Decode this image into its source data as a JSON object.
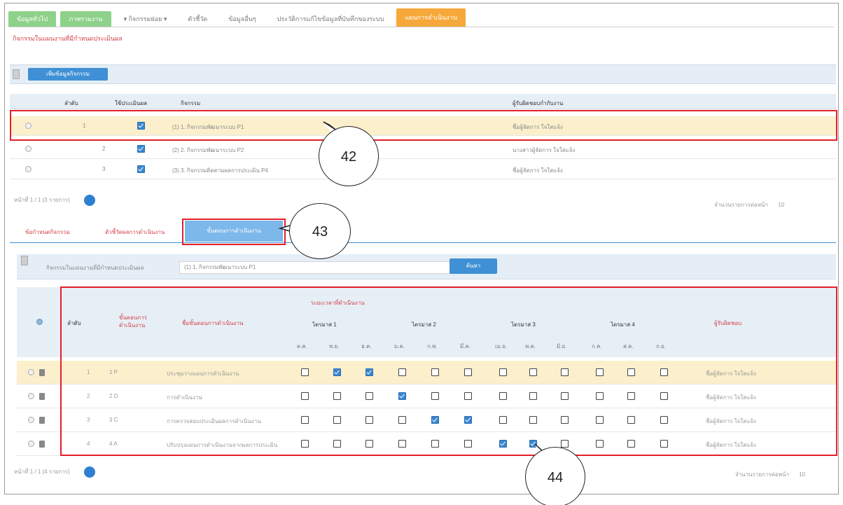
{
  "nav": {
    "tabs": [
      "ข้อมูลทั่วไป",
      "ภาพรวมงาน",
      "▾ กิจกรรมย่อย ▾",
      "ตัวชี้วัด",
      "ข้อมูลอื่นๆ",
      "ประวัติการแก้ไขข้อมูลที่บันทึกของระบบ",
      "แผนการดำเนินงาน"
    ]
  },
  "section_title": "กิจกรรมในแผนงานที่มีกำหนดประเมินผล",
  "add_button": "เพิ่มข้อมูลกิจกรรม",
  "upper_table": {
    "headers": [
      "ลำดับ",
      "ใช้ประเมินผล",
      "กิจกรรม",
      "ผู้รับผิดชอบกำกับงาน"
    ],
    "rows": [
      {
        "no": "1",
        "activity": "(1) 1. กิจกรรมพัฒนาระบบ P1",
        "owner": "ชื่อผู้จัดการ ใจใสแจ้ง"
      },
      {
        "no": "2",
        "activity": "(2) 2. กิจกรรมพัฒนาระบบ P2",
        "owner": "นางสาวผู้จัดการ ใจใสแจ้ง"
      },
      {
        "no": "3",
        "activity": "(3) 3. กิจกรรมติดตามผลการประเมิน P4",
        "owner": "ชื่อผู้จัดการ ใจใสแจ้ง"
      }
    ],
    "pager": "หน้าที่ 1 / 1 (3 รายการ)",
    "page": "1",
    "right_text": "จำนวนรายการต่อหน้า",
    "right_val": "10"
  },
  "subtabs": [
    "ข้อกำหนดกิจกรรม",
    "ตัวชี้วัดผลการดำเนินงาน",
    "ขั้นตอนการดำเนินงาน"
  ],
  "filter": {
    "label": "กิจกรรมในแผนงานที่มีกำหนดประเมินผล",
    "value": "(1) 1. กิจกรรมพัฒนาระบบ P1",
    "button": "ค้นหา"
  },
  "lower_table": {
    "header_no": "ลำดับ",
    "header_code": "ขั้นตอนการ ดำเนินงาน",
    "header_name": "ชื่อขั้นตอนการดำเนินงาน",
    "header_period": "ระยะเวลาที่ดำเนินงาน",
    "quarters": [
      "ไตรมาส 1",
      "ไตรมาส 2",
      "ไตรมาส 3",
      "ไตรมาส 4"
    ],
    "months": [
      "ต.ค.",
      "พ.ย.",
      "ธ.ค.",
      "ม.ค.",
      "ก.พ.",
      "มี.ค.",
      "เม.ย.",
      "พ.ค.",
      "มิ.ย.",
      "ก.ค.",
      "ส.ค.",
      "ก.ย."
    ],
    "header_owner": "ผู้รับผิดชอบ",
    "rows": [
      {
        "no": "1",
        "code": "1 P",
        "name": "ประชุมวางแผนการดำเนินงาน",
        "checks": [
          0,
          1,
          1,
          0,
          0,
          0,
          0,
          0,
          0,
          0,
          0,
          0
        ],
        "owner": "ชื่อผู้จัดการ ใจใสแจ้ง"
      },
      {
        "no": "2",
        "code": "2 D",
        "name": "การดำเนินงาน",
        "checks": [
          0,
          0,
          0,
          1,
          0,
          0,
          0,
          0,
          0,
          0,
          0,
          0
        ],
        "owner": "ชื่อผู้จัดการ ใจใสแจ้ง"
      },
      {
        "no": "3",
        "code": "3 C",
        "name": "การตรวจสอบประเมินผลการดำเนินงาน",
        "checks": [
          0,
          0,
          0,
          0,
          1,
          1,
          0,
          0,
          0,
          0,
          0,
          0
        ],
        "owner": "ชื่อผู้จัดการ ใจใสแจ้ง"
      },
      {
        "no": "4",
        "code": "4 A",
        "name": "ปรับปรุงแผนการดำเนินงานจากผลการประเมิน",
        "checks": [
          0,
          0,
          0,
          0,
          0,
          0,
          1,
          1,
          0,
          0,
          0,
          0
        ],
        "owner": "ชื่อผู้จัดการ ใจใสแจ้ง"
      }
    ],
    "pager": "หน้าที่ 1 / 1 (4 รายการ)",
    "page": "1",
    "right_text": "จำนวนรายการต่อหน้า",
    "right_val": "10"
  },
  "callouts": [
    "42",
    "43",
    "44"
  ]
}
